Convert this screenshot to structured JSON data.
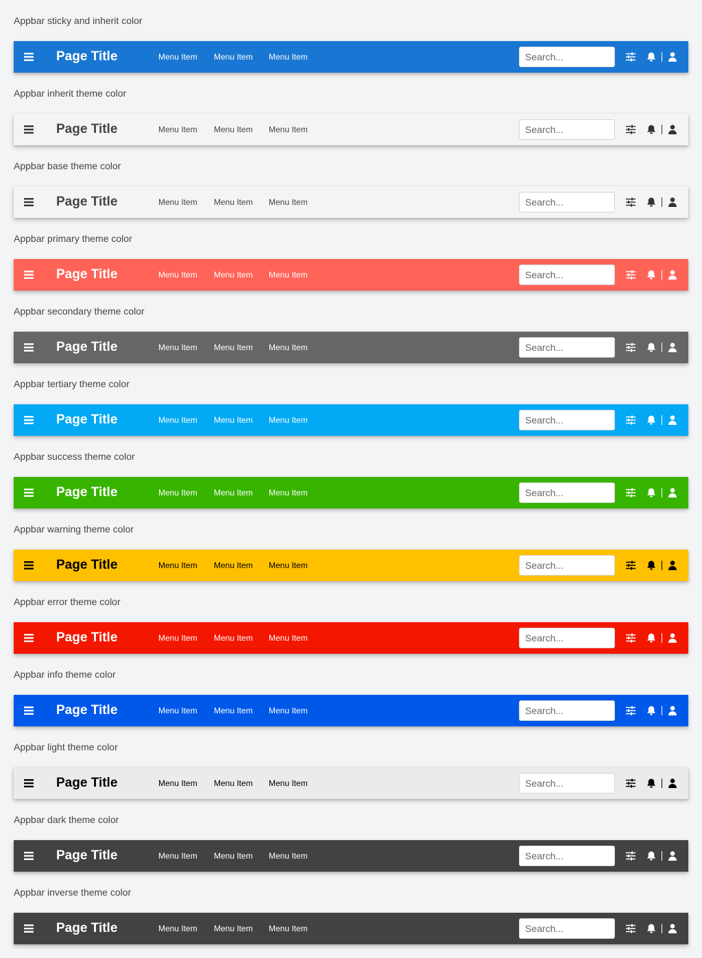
{
  "appbar": {
    "title": "Page Title",
    "menu_items": [
      "Menu Item",
      "Menu Item",
      "Menu Item"
    ],
    "search_placeholder": "Search...",
    "icons": [
      "menu-icon",
      "tune-icon",
      "bell-icon",
      "user-icon"
    ]
  },
  "sections": [
    {
      "caption": "Appbar sticky and inherit color",
      "bg": "#1976d2",
      "fg": "#ffffff",
      "title_fg": "#ffffff",
      "menu_fg": "#ffffff"
    },
    {
      "caption": "Appbar inherit theme color",
      "bg": "#f4f4f5",
      "fg": "#333333",
      "title_fg": "#444444",
      "menu_fg": "#444444"
    },
    {
      "caption": "Appbar base theme color",
      "bg": "#f4f4f5",
      "fg": "#333333",
      "title_fg": "#444444",
      "menu_fg": "#444444"
    },
    {
      "caption": "Appbar primary theme color",
      "bg": "#ff6358",
      "fg": "#ffffff",
      "title_fg": "#ffffff",
      "menu_fg": "#ffffff"
    },
    {
      "caption": "Appbar secondary theme color",
      "bg": "#666666",
      "fg": "#ffffff",
      "title_fg": "#ffffff",
      "menu_fg": "#ffffff"
    },
    {
      "caption": "Appbar tertiary theme color",
      "bg": "#03a9f4",
      "fg": "#ffffff",
      "title_fg": "#ffffff",
      "menu_fg": "#ffffff"
    },
    {
      "caption": "Appbar success theme color",
      "bg": "#37b400",
      "fg": "#ffffff",
      "title_fg": "#ffffff",
      "menu_fg": "#ffffff"
    },
    {
      "caption": "Appbar warning theme color",
      "bg": "#ffc000",
      "fg": "#000000",
      "title_fg": "#000000",
      "menu_fg": "#000000"
    },
    {
      "caption": "Appbar error theme color",
      "bg": "#f31700",
      "fg": "#ffffff",
      "title_fg": "#ffffff",
      "menu_fg": "#ffffff"
    },
    {
      "caption": "Appbar info theme color",
      "bg": "#0058e9",
      "fg": "#ffffff",
      "title_fg": "#ffffff",
      "menu_fg": "#ffffff"
    },
    {
      "caption": "Appbar light theme color",
      "bg": "#ebebeb",
      "fg": "#000000",
      "title_fg": "#000000",
      "menu_fg": "#000000"
    },
    {
      "caption": "Appbar dark theme color",
      "bg": "#424242",
      "fg": "#ffffff",
      "title_fg": "#ffffff",
      "menu_fg": "#ffffff"
    },
    {
      "caption": "Appbar inverse theme color",
      "bg": "#424242",
      "fg": "#ffffff",
      "title_fg": "#ffffff",
      "menu_fg": "#ffffff"
    }
  ]
}
